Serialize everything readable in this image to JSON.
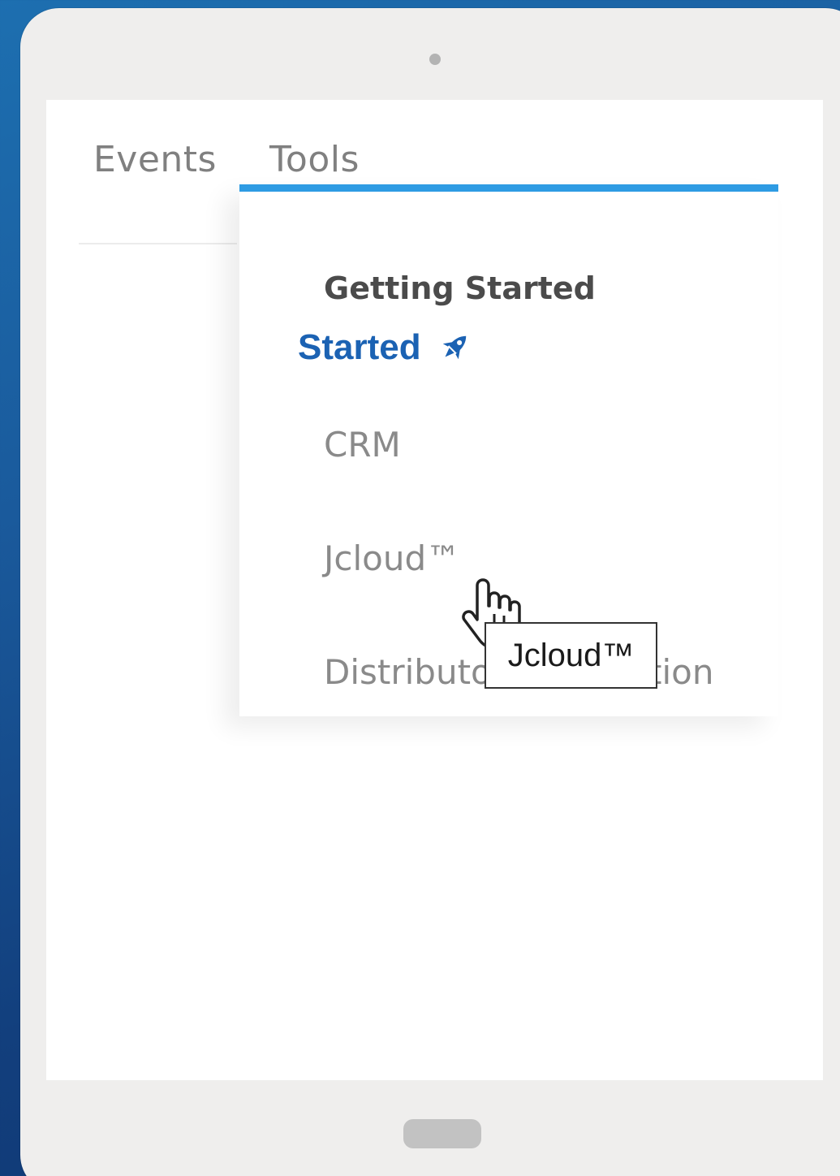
{
  "nav": {
    "items": [
      {
        "label": "Events"
      },
      {
        "label": "Tools"
      }
    ],
    "active": "Tools"
  },
  "dropdown": {
    "heading": "Getting Started",
    "started_label": "Started",
    "started_icon": "rocket-icon",
    "items": [
      {
        "label": "CRM"
      },
      {
        "label": "Jcloud™"
      },
      {
        "label": "Distributor Information"
      }
    ]
  },
  "tooltip": {
    "text": "Jcloud™"
  },
  "colors": {
    "accent": "#2e9be3",
    "link": "#1b62b3",
    "muted_text": "#8a8a8a",
    "heading_text": "#4b4b4b"
  }
}
